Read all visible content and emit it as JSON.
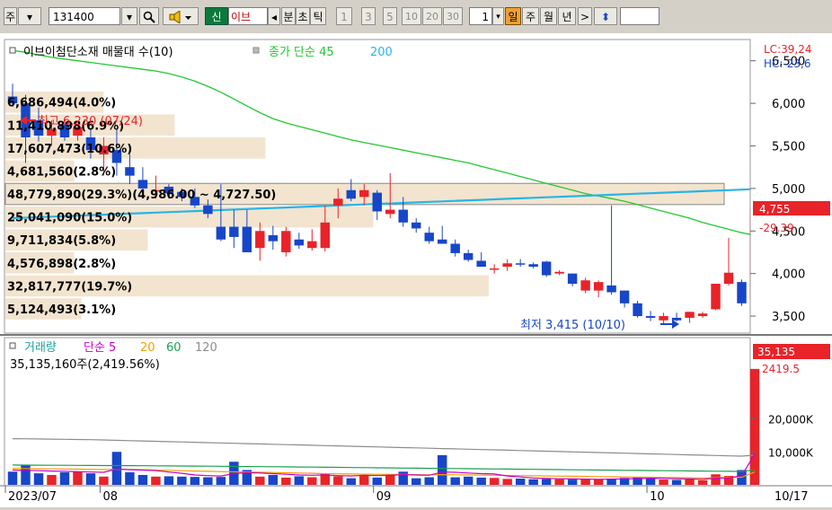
{
  "toolbar": {
    "market_label": "주",
    "code_value": "131400",
    "shin_label": "신",
    "name_fragment": "이브",
    "prev_arrow": "◂",
    "bun_label": "분",
    "cho_label": "초",
    "tick_label": "틱",
    "interval_buttons": [
      "1",
      "3",
      "5",
      "10",
      "20",
      "30"
    ],
    "interval_value": "1",
    "day_label": "일",
    "week_label": "주",
    "month_label": "월",
    "year_label": "년",
    "next_arrow": ">",
    "updown_glyph": "⬍"
  },
  "legend": {
    "main_title": "이브이첨단소재 매물대 수(10)",
    "ma_label": "종가 단순 45",
    "ma_value": "200",
    "volume_title": "거래량",
    "volume_ma_label": "단순 5",
    "volume_ma_periods": [
      "20",
      "60",
      "120"
    ],
    "volume_summary": "35,135,160주(2,419.56%)"
  },
  "annotations": {
    "high_label": "최고 6,230 (07/24)",
    "low_label": "최저 3,415 (10/10)",
    "lc_label": "LC:39,24",
    "hc_label": "HC:-23,6",
    "last_price": "4,755",
    "last_change": "-29.39",
    "last_volume": "35,135",
    "last_volume_pct": "2419.5",
    "highlight_band": "48,779,890(29.3%)(4,986.00 ~ 4,727.50)"
  },
  "x_axis_labels": [
    "2023/07",
    "08",
    "09",
    "10",
    "10/17"
  ],
  "colors": {
    "up": "#e8232a",
    "down": "#1746c8",
    "ma_short": "#22c832",
    "ma_long": "#28b4e6",
    "profile": "#f2e4cf",
    "vol_ma5": "#c800c8",
    "vol_ma20": "#f0a000",
    "vol_ma60": "#1aa050",
    "vol_ma120": "#8c8c8c"
  },
  "chart_data": [
    {
      "type": "candlestick",
      "title": "이브이첨단소재 매물대 수(10)",
      "ylim": [
        3300,
        6750
      ],
      "yticks": [
        3500,
        4000,
        4500,
        5000,
        5500,
        6000,
        6500
      ],
      "ytick_labels": [
        "3,500",
        "4,000",
        "4,500",
        "5,000",
        "5,500",
        "6,000",
        "6,500"
      ],
      "candles": [
        {
          "o": 6080,
          "h": 6230,
          "l": 5960,
          "c": 6000
        },
        {
          "o": 6000,
          "h": 6100,
          "l": 5300,
          "c": 5600
        },
        {
          "o": 5800,
          "h": 5950,
          "l": 5550,
          "c": 5620
        },
        {
          "o": 5620,
          "h": 5800,
          "l": 5500,
          "c": 5700
        },
        {
          "o": 5750,
          "h": 5820,
          "l": 5560,
          "c": 5600
        },
        {
          "o": 5620,
          "h": 5760,
          "l": 5560,
          "c": 5720
        },
        {
          "o": 5600,
          "h": 5700,
          "l": 5350,
          "c": 5450
        },
        {
          "o": 5400,
          "h": 5600,
          "l": 5150,
          "c": 5500
        },
        {
          "o": 5450,
          "h": 5700,
          "l": 5150,
          "c": 5300
        },
        {
          "o": 5250,
          "h": 5400,
          "l": 5050,
          "c": 5150
        },
        {
          "o": 5100,
          "h": 5250,
          "l": 4950,
          "c": 5000
        },
        {
          "o": 4980,
          "h": 5150,
          "l": 4880,
          "c": 4980
        },
        {
          "o": 5020,
          "h": 5050,
          "l": 4880,
          "c": 4940
        },
        {
          "o": 4960,
          "h": 5000,
          "l": 4850,
          "c": 4900
        },
        {
          "o": 4900,
          "h": 5000,
          "l": 4770,
          "c": 4800
        },
        {
          "o": 4800,
          "h": 4870,
          "l": 4650,
          "c": 4700
        },
        {
          "o": 4550,
          "h": 5050,
          "l": 4380,
          "c": 4400
        },
        {
          "o": 4550,
          "h": 4750,
          "l": 4300,
          "c": 4430
        },
        {
          "o": 4550,
          "h": 4750,
          "l": 4280,
          "c": 4250
        },
        {
          "o": 4300,
          "h": 4600,
          "l": 4150,
          "c": 4500
        },
        {
          "o": 4450,
          "h": 4560,
          "l": 4280,
          "c": 4380
        },
        {
          "o": 4250,
          "h": 4550,
          "l": 4200,
          "c": 4500
        },
        {
          "o": 4400,
          "h": 4480,
          "l": 4290,
          "c": 4330
        },
        {
          "o": 4300,
          "h": 4520,
          "l": 4270,
          "c": 4380
        },
        {
          "o": 4300,
          "h": 4800,
          "l": 4260,
          "c": 4600
        },
        {
          "o": 4800,
          "h": 5000,
          "l": 4650,
          "c": 4880
        },
        {
          "o": 4980,
          "h": 5110,
          "l": 4850,
          "c": 4880
        },
        {
          "o": 4900,
          "h": 5050,
          "l": 4800,
          "c": 4980
        },
        {
          "o": 4950,
          "h": 4980,
          "l": 4630,
          "c": 4730
        },
        {
          "o": 4700,
          "h": 5180,
          "l": 4650,
          "c": 4750
        },
        {
          "o": 4750,
          "h": 4900,
          "l": 4550,
          "c": 4600
        },
        {
          "o": 4600,
          "h": 4650,
          "l": 4480,
          "c": 4530
        },
        {
          "o": 4480,
          "h": 4550,
          "l": 4350,
          "c": 4380
        },
        {
          "o": 4400,
          "h": 4560,
          "l": 4350,
          "c": 4350
        },
        {
          "o": 4350,
          "h": 4400,
          "l": 4200,
          "c": 4240
        },
        {
          "o": 4240,
          "h": 4280,
          "l": 4140,
          "c": 4160
        },
        {
          "o": 4150,
          "h": 4250,
          "l": 4080,
          "c": 4080
        },
        {
          "o": 4060,
          "h": 4110,
          "l": 4000,
          "c": 4060
        },
        {
          "o": 4080,
          "h": 4170,
          "l": 4030,
          "c": 4120
        },
        {
          "o": 4120,
          "h": 4170,
          "l": 4080,
          "c": 4110
        },
        {
          "o": 4110,
          "h": 4130,
          "l": 4060,
          "c": 4080
        },
        {
          "o": 4140,
          "h": 4150,
          "l": 3960,
          "c": 3980
        },
        {
          "o": 4000,
          "h": 4040,
          "l": 3980,
          "c": 4020
        },
        {
          "o": 4000,
          "h": 4000,
          "l": 3850,
          "c": 3880
        },
        {
          "o": 3800,
          "h": 3950,
          "l": 3770,
          "c": 3920
        },
        {
          "o": 3800,
          "h": 3920,
          "l": 3720,
          "c": 3900
        },
        {
          "o": 3860,
          "h": 4800,
          "l": 3750,
          "c": 3780
        },
        {
          "o": 3800,
          "h": 3800,
          "l": 3600,
          "c": 3650
        },
        {
          "o": 3650,
          "h": 3680,
          "l": 3480,
          "c": 3500
        },
        {
          "o": 3500,
          "h": 3560,
          "l": 3440,
          "c": 3480
        },
        {
          "o": 3450,
          "h": 3540,
          "l": 3415,
          "c": 3500
        },
        {
          "o": 3480,
          "h": 3540,
          "l": 3440,
          "c": 3450
        },
        {
          "o": 3480,
          "h": 3550,
          "l": 3420,
          "c": 3550
        },
        {
          "o": 3500,
          "h": 3550,
          "l": 3480,
          "c": 3530
        },
        {
          "o": 3580,
          "h": 3880,
          "l": 3570,
          "c": 3880
        },
        {
          "o": 3880,
          "h": 4420,
          "l": 3860,
          "c": 4010
        },
        {
          "o": 3900,
          "h": 3930,
          "l": 3620,
          "c": 3650
        },
        {
          "o": 3700,
          "h": 4790,
          "l": 3680,
          "c": 4755
        }
      ],
      "ma45": [
        6620,
        6600,
        6570,
        6540,
        6520,
        6500,
        6480,
        6460,
        6440,
        6420,
        6400,
        6380,
        6350,
        6310,
        6260,
        6200,
        6130,
        6050,
        5970,
        5890,
        5820,
        5770,
        5730,
        5690,
        5650,
        5610,
        5570,
        5540,
        5510,
        5480,
        5450,
        5420,
        5390,
        5360,
        5330,
        5300,
        5260,
        5220,
        5180,
        5140,
        5100,
        5060,
        5020,
        4980,
        4940,
        4910,
        4880,
        4850,
        4810,
        4770,
        4730,
        4690,
        4650,
        4600,
        4560,
        4520,
        4480,
        4450
      ],
      "ma200": [
        4650,
        4656,
        4662,
        4668,
        4674,
        4680,
        4686,
        4692,
        4698,
        4704,
        4710,
        4716,
        4722,
        4728,
        4734,
        4740,
        4746,
        4752,
        4758,
        4764,
        4770,
        4776,
        4782,
        4788,
        4794,
        4800,
        4806,
        4812,
        4818,
        4824,
        4830,
        4836,
        4842,
        4848,
        4854,
        4860,
        4866,
        4872,
        4878,
        4884,
        4890,
        4896,
        4902,
        4908,
        4914,
        4920,
        4926,
        4932,
        4938,
        4944,
        4950,
        4956,
        4962,
        4968,
        4974,
        4980,
        4986,
        4992
      ],
      "volume_profile": [
        {
          "label": "6,686,494(4.0%)",
          "share": 4.0
        },
        {
          "label": "11,410,898(6.9%)",
          "share": 6.9
        },
        {
          "label": "17,607,473(10.6%)",
          "share": 10.6
        },
        {
          "label": "4,681,560(2.8%)",
          "share": 2.8
        },
        {
          "label": "48,779,890(29.3%)(4,986.00 ~ 4,727.50)",
          "share": 29.3
        },
        {
          "label": "25,041,090(15.0%)",
          "share": 15.0
        },
        {
          "label": "9,711,834(5.8%)",
          "share": 5.8
        },
        {
          "label": "4,576,898(2.8%)",
          "share": 2.8
        },
        {
          "label": "32,817,777(19.7%)",
          "share": 19.7
        },
        {
          "label": "5,124,493(3.1%)",
          "share": 3.1
        }
      ]
    },
    {
      "type": "bar",
      "title": "거래량",
      "unit": "K",
      "ylim": [
        0,
        40000
      ],
      "yticks": [
        10000,
        20000
      ],
      "ytick_labels": [
        "10,000K",
        "20,000K"
      ],
      "volumes": [
        4000,
        6000,
        3500,
        3000,
        3800,
        4000,
        3500,
        2500,
        10000,
        3800,
        3000,
        2500,
        2600,
        2500,
        2400,
        2300,
        2400,
        7000,
        4500,
        2500,
        3000,
        2200,
        2600,
        2300,
        3500,
        2600,
        2000,
        3000,
        2200,
        3200,
        4000,
        2000,
        2300,
        9000,
        2300,
        2500,
        2200,
        2100,
        1800,
        1900,
        1700,
        1800,
        1700,
        1600,
        1800,
        1700,
        1900,
        2100,
        2300,
        2000,
        1600,
        1500,
        1700,
        1400,
        3200,
        2700,
        4500,
        35135
      ],
      "ma5": [
        4500,
        4400,
        4300,
        4200,
        4100,
        4000,
        3900,
        3800,
        4800,
        4600,
        4500,
        4300,
        3900,
        3500,
        3000,
        2800,
        2700,
        3400,
        3700,
        3600,
        3400,
        3200,
        3000,
        2900,
        3000,
        2800,
        2700,
        2900,
        2800,
        2900,
        3100,
        3000,
        2900,
        3900,
        3800,
        3600,
        3400,
        3300,
        2700,
        2400,
        2100,
        1950,
        1850,
        1800,
        1750,
        1700,
        1750,
        1800,
        1900,
        2000,
        1950,
        1850,
        1800,
        1700,
        2000,
        2100,
        2800,
        9300
      ],
      "ma20": [
        5000,
        4950,
        4900,
        4850,
        4800,
        4750,
        4700,
        4650,
        4700,
        4650,
        4600,
        4500,
        4400,
        4300,
        4200,
        4100,
        4000,
        3950,
        3900,
        3850,
        3750,
        3650,
        3600,
        3500,
        3400,
        3350,
        3300,
        3250,
        3200,
        3180,
        3150,
        3100,
        3050,
        3100,
        3050,
        3000,
        2950,
        2900,
        2850,
        2800,
        2750,
        2700,
        2650,
        2600,
        2550,
        2500,
        2450,
        2400,
        2350,
        2300,
        2250,
        2200,
        2150,
        2100,
        2150,
        2200,
        2300,
        3900
      ],
      "ma60": [
        6000,
        5980,
        5960,
        5940,
        5920,
        5900,
        5880,
        5860,
        5840,
        5820,
        5800,
        5770,
        5740,
        5710,
        5680,
        5650,
        5620,
        5590,
        5560,
        5530,
        5500,
        5460,
        5420,
        5380,
        5340,
        5300,
        5260,
        5220,
        5180,
        5140,
        5100,
        5060,
        5020,
        4980,
        4940,
        4900,
        4860,
        4820,
        4780,
        4740,
        4700,
        4660,
        4620,
        4580,
        4540,
        4500,
        4460,
        4420,
        4380,
        4340,
        4300,
        4260,
        4220,
        4180,
        4140,
        4100,
        4060,
        4550
      ],
      "ma120": [
        14000,
        13950,
        13900,
        13850,
        13800,
        13750,
        13700,
        13600,
        13500,
        13400,
        13300,
        13200,
        13100,
        13000,
        12900,
        12800,
        12700,
        12600,
        12500,
        12400,
        12300,
        12200,
        12100,
        12000,
        11900,
        11800,
        11700,
        11600,
        11500,
        11400,
        11300,
        11200,
        11100,
        11000,
        10900,
        10800,
        10700,
        10600,
        10500,
        10400,
        10300,
        10200,
        10100,
        10000,
        9900,
        9800,
        9700,
        9600,
        9500,
        9400,
        9300,
        9200,
        9100,
        9000,
        8900,
        8800,
        8700,
        9000
      ]
    }
  ]
}
